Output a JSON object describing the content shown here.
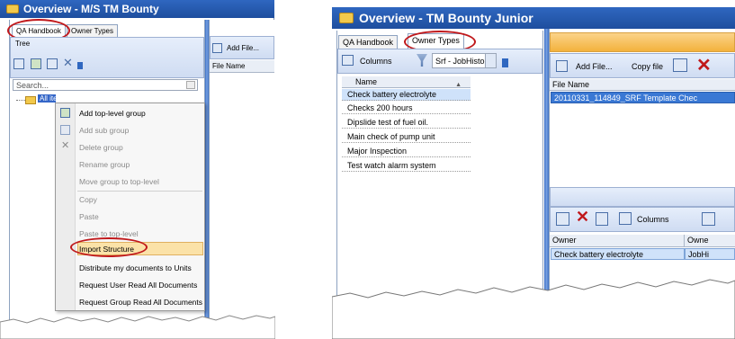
{
  "left_window": {
    "title": "Overview - M/S TM Bounty",
    "tabs": [
      "QA Handbook",
      "Owner Types"
    ],
    "tree_label": "Tree",
    "search_placeholder": "Search...",
    "tree_root": "All items",
    "right_toolbar": {
      "add_file": "Add File..."
    },
    "file_column": "File Name",
    "context_menu": [
      "Add top-level group",
      "Add sub group",
      "Delete group",
      "Rename group",
      "Move group to top-level",
      "Copy",
      "Paste",
      "Paste to top-level",
      "Import Structure",
      "Distribute my documents to Units",
      "Request User Read All Documents",
      "Request Group Read All Documents"
    ]
  },
  "right_window": {
    "title": "Overview - TM Bounty Junior",
    "tabs": [
      "QA Handbook",
      "Owner Types"
    ],
    "columns_btn": "Columns",
    "filter_value": "Srf - JobHistory",
    "name_header": "Name",
    "names": [
      "Check battery electrolyte",
      "Checks 200 hours",
      "Dipslide test of fuel oil.",
      "Main check of pump unit",
      "Major Inspection",
      "Test watch alarm system"
    ],
    "toolbar": {
      "add_file": "Add File...",
      "copy_file": "Copy file"
    },
    "file_column": "File Name",
    "file_row": "20110331_114849_SRF Template Chec",
    "bottom_columns_btn": "Columns",
    "owner_header": "Owner",
    "owner_header2": "Owne",
    "owner_row": "Check battery electrolyte",
    "owner_row2": "JobHi"
  },
  "colors": {
    "title_blue": "#1e4e9e",
    "highlight_red": "#c0181b",
    "accent_orange": "#f3b23c"
  }
}
